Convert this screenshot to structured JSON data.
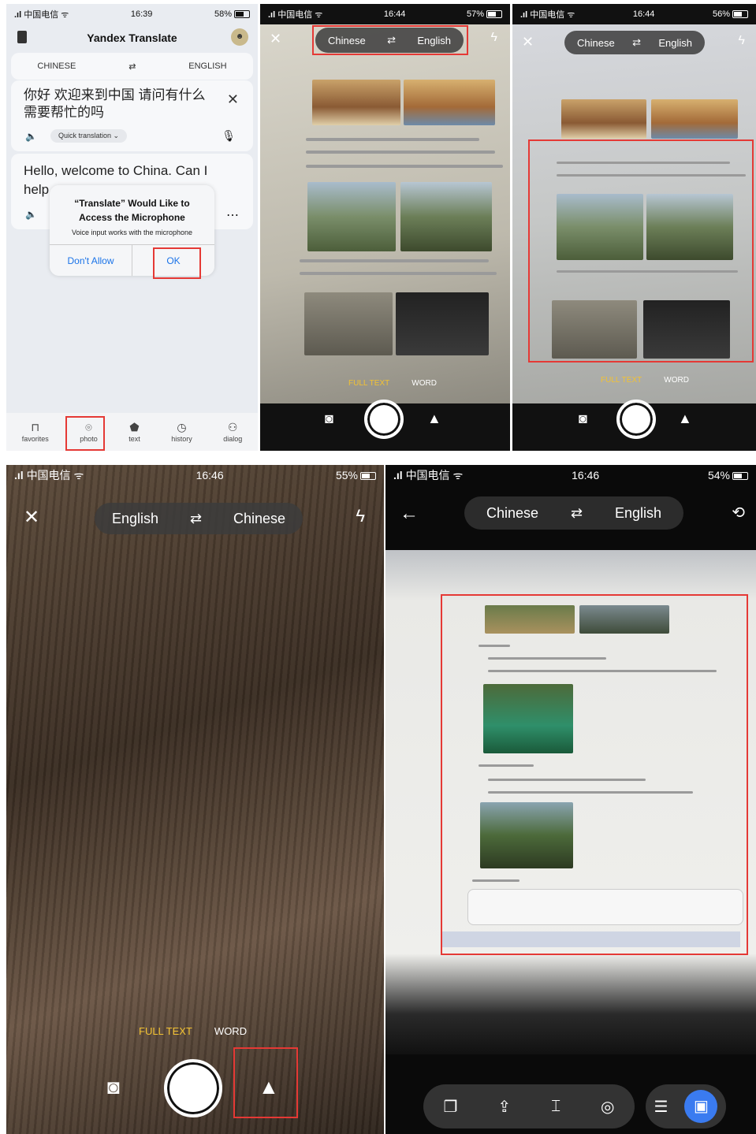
{
  "p1": {
    "status": {
      "carrier": "中国电信",
      "time": "16:39",
      "battery": "58%"
    },
    "app_title": "Yandex Translate",
    "source_lang": "CHINESE",
    "target_lang": "ENGLISH",
    "source_text": "你好 欢迎来到中国 请问有什么需要帮忙的吗",
    "quick_translation": "Quick translation",
    "translated_text": "Hello, welcome to China. Can I help",
    "dialog": {
      "title": "“Translate” Would Like to Access the Microphone",
      "message": "Voice input works with the microphone",
      "deny": "Don't Allow",
      "ok": "OK"
    },
    "tabs": [
      {
        "label": "favorites",
        "icon": "bookmark-icon"
      },
      {
        "label": "photo",
        "icon": "camera-icon"
      },
      {
        "label": "text",
        "icon": "text-icon"
      },
      {
        "label": "history",
        "icon": "history-icon"
      },
      {
        "label": "dialog",
        "icon": "people-icon"
      }
    ]
  },
  "p2": {
    "status": {
      "carrier": "中国电信",
      "time": "16:44",
      "battery": "57%"
    },
    "lang_from": "Chinese",
    "lang_to": "English",
    "mode_full": "FULL TEXT",
    "mode_word": "WORD"
  },
  "p3": {
    "status": {
      "carrier": "中国电信",
      "time": "16:44",
      "battery": "56%"
    },
    "lang_from": "Chinese",
    "lang_to": "English",
    "mode_full": "FULL TEXT",
    "mode_word": "WORD"
  },
  "p4": {
    "status": {
      "carrier": "中国电信",
      "time": "16:46",
      "battery": "55%"
    },
    "lang_from": "English",
    "lang_to": "Chinese",
    "mode_full": "FULL TEXT",
    "mode_word": "WORD"
  },
  "p5": {
    "status": {
      "carrier": "中国电信",
      "time": "16:46",
      "battery": "54%"
    },
    "lang_from": "Chinese",
    "lang_to": "English"
  },
  "colors": {
    "accent_red": "#e53935",
    "mode_active": "#f2c233",
    "link_blue": "#1a73e8"
  }
}
